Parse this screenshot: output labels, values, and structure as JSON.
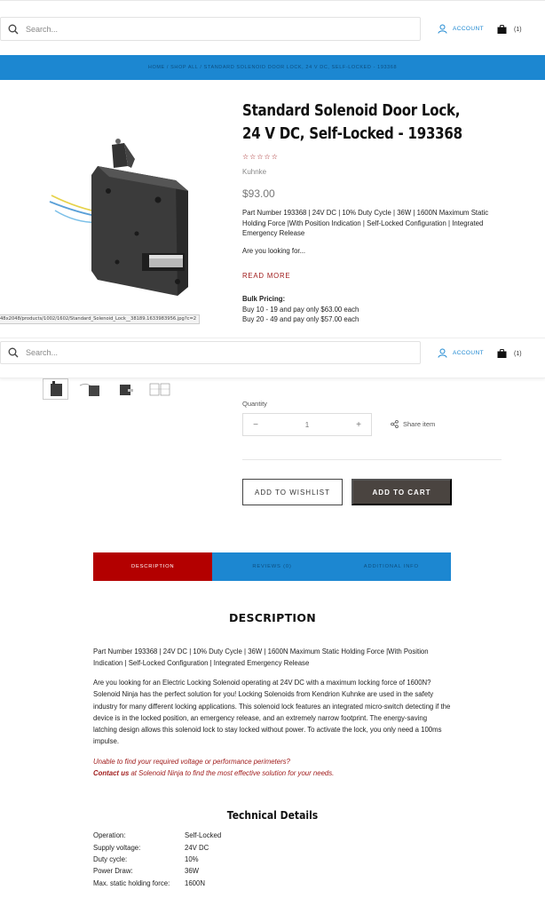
{
  "header": {
    "search_placeholder": "Search...",
    "account_label": "ACCOUNT",
    "cart_count": "(1)"
  },
  "breadcrumb": "HOME / SHOP ALL / STANDARD SOLENOID DOOR LOCK, 24 V DC, SELF-LOCKED - 193368",
  "status_url": "48x2048/products/1002/1602/Standard_Solenoid_Lock__38189.1633983956.jpg?c=2",
  "product": {
    "title": "Standard Solenoid Door Lock, 24 V DC, Self-Locked - 193368",
    "rating_stars": "☆☆☆☆☆",
    "brand": "Kuhnke",
    "price": "$93.00",
    "description": "Part Number 193368 | 24V DC | 10% Duty Cycle | 36W | 1600N Maximum Static Holding Force |With Position Indication | Self-Locked Configuration | Integrated Emergency Release",
    "looking_for": "Are you looking for...",
    "read_more": "READ MORE",
    "bulk_title": "Bulk Pricing:",
    "bulk_lines": [
      "Buy 10 - 19 and pay only $63.00 each",
      "Buy 20 - 49 and pay only $57.00 each"
    ]
  },
  "purchase": {
    "quantity_label": "Quantity",
    "quantity_value": "1",
    "minus": "−",
    "plus": "+",
    "share_label": "Share item",
    "wishlist_label": "ADD TO WISHLIST",
    "cart_label": "ADD TO CART"
  },
  "tabs": [
    {
      "label": "DESCRIPTION",
      "active": true
    },
    {
      "label": "REVIEWS (0)",
      "active": false
    },
    {
      "label": "ADDITIONAL INFO",
      "active": false
    }
  ],
  "description_section": {
    "title": "DESCRIPTION",
    "para1": "Part Number 193368 | 24V DC | 10% Duty Cycle | 36W | 1600N Maximum Static Holding Force |With Position Indication | Self-Locked Configuration | Integrated Emergency Release",
    "para2": "Are you looking for an Electric Locking Solenoid operating at 24V DC with a maximum locking force of 1600N? Solenoid Ninja has the perfect solution for you! Locking Solenoids from Kendrion Kuhnke are used in the safety industry for many different locking applications. This solenoid lock features an integrated micro-switch detecting if the device is in the locked position, an emergency release, and an extremely narrow footprint. The energy-saving latching design allows this solenoid lock to stay locked without power. To activate the lock, you only need a 100ms impulse.",
    "contact_line1": "Unable to find your required voltage or performance perimeters?",
    "contact_link": "Contact us",
    "contact_rest": " at Solenoid Ninja to find the most effective solution for your needs."
  },
  "technical": {
    "title": "Technical Details",
    "rows": [
      {
        "key": "Operation:",
        "value": "Self-Locked"
      },
      {
        "key": "Supply voltage:",
        "value": "24V DC"
      },
      {
        "key": "Duty cycle:",
        "value": "10%"
      },
      {
        "key": "Power Draw:",
        "value": "36W"
      },
      {
        "key": "Max. static holding force:",
        "value": "1600N"
      }
    ]
  },
  "colors": {
    "accent_blue": "#1c87d1",
    "accent_red": "#b30000",
    "cart_button": "#4a4440"
  }
}
